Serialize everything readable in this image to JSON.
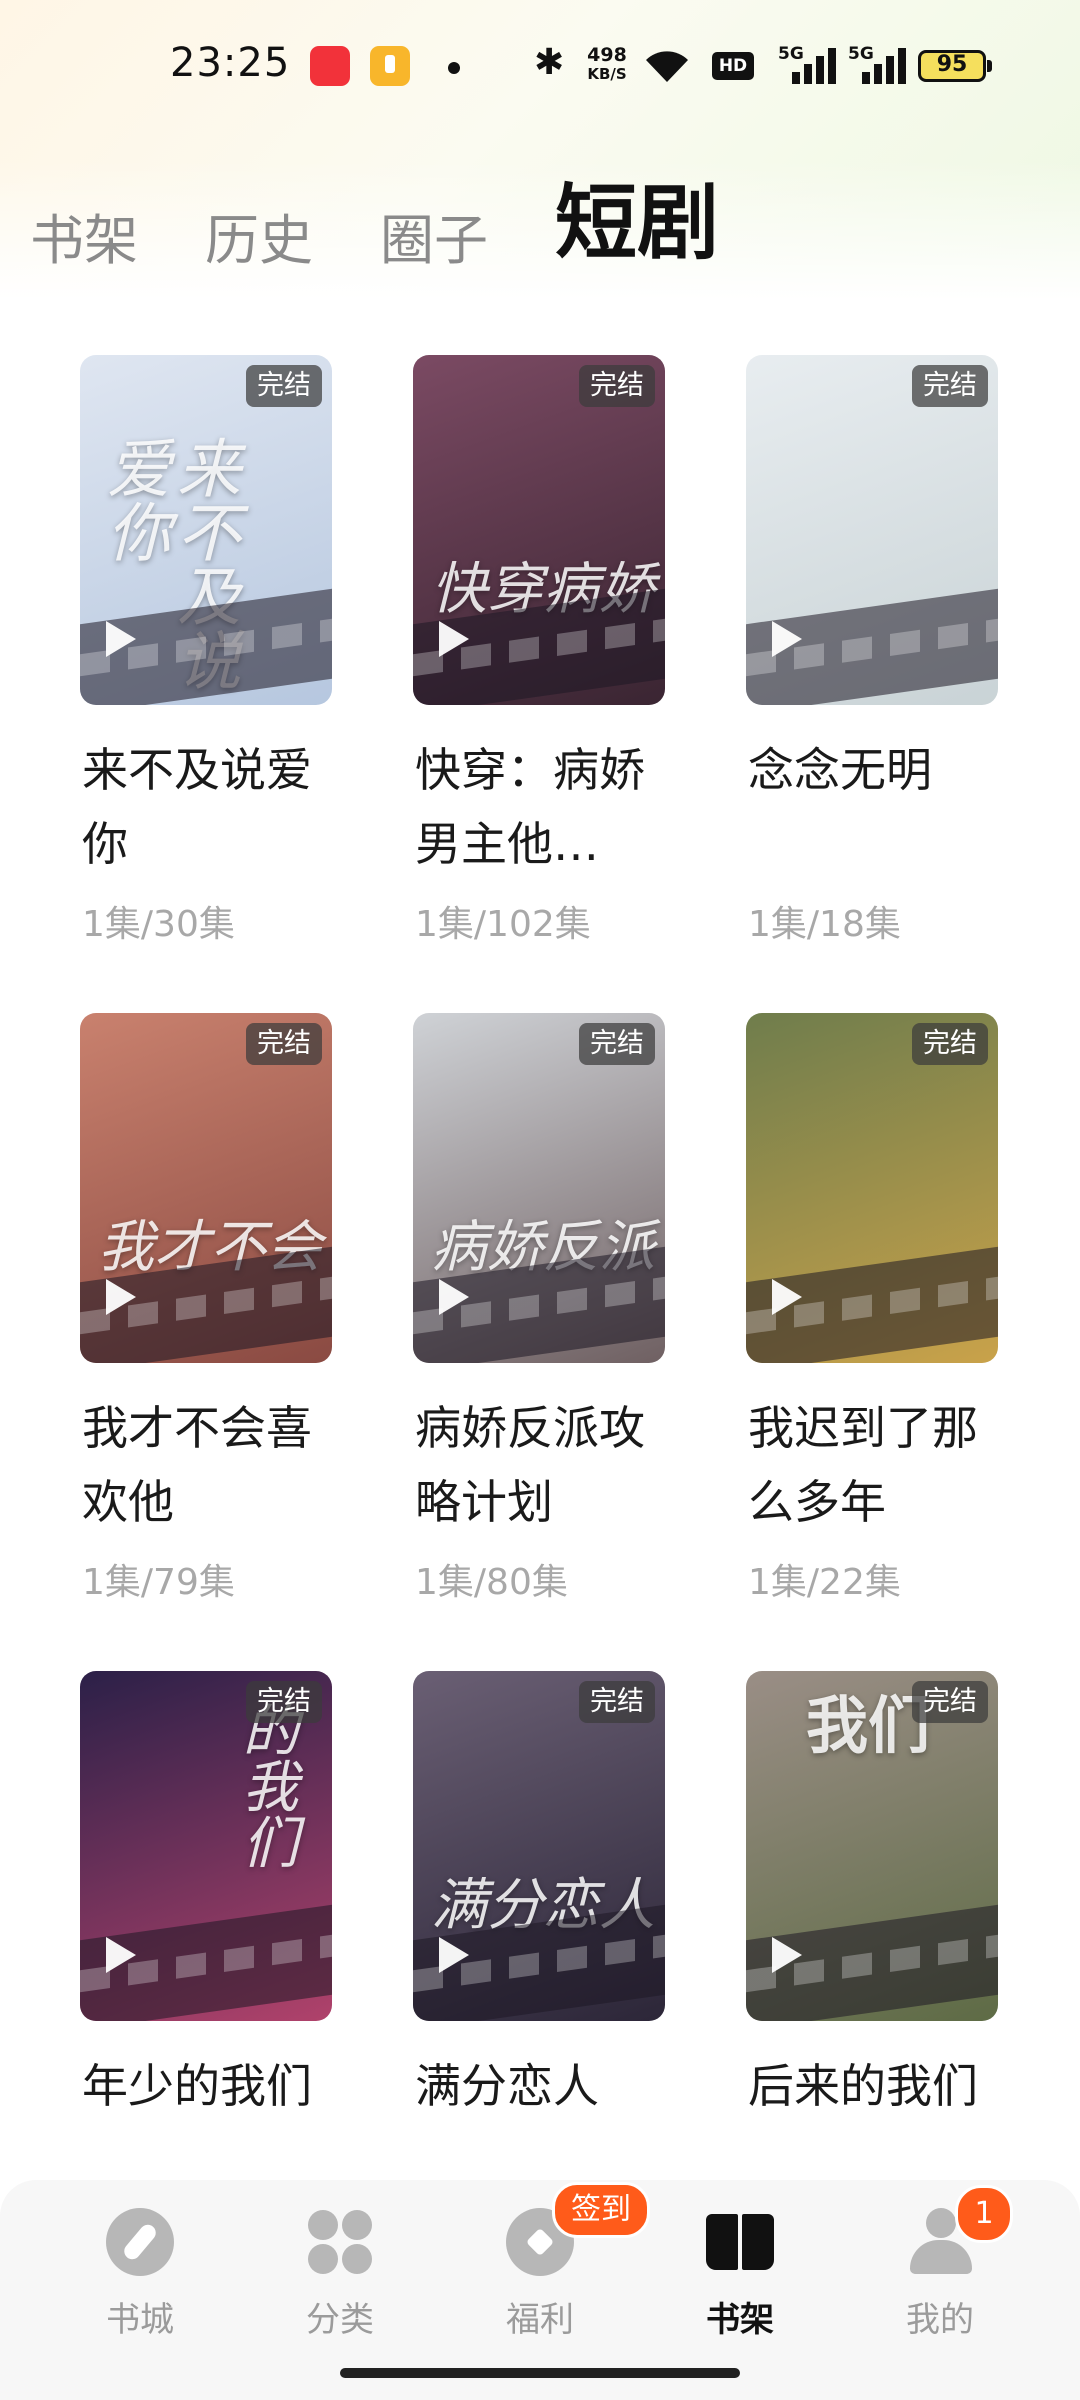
{
  "status_bar": {
    "time": "23:25",
    "net_speed_value": "498",
    "net_speed_unit": "KB/S",
    "hd_label": "HD",
    "signal1_label": "5G",
    "signal2_label": "5G",
    "battery": "95"
  },
  "tabs": [
    {
      "label": "书架",
      "active": false
    },
    {
      "label": "历史",
      "active": false
    },
    {
      "label": "圈子",
      "active": false
    },
    {
      "label": "短剧",
      "active": true
    }
  ],
  "dramas": [
    {
      "title": "来不及说爱你",
      "episodes": "1集/30集",
      "badge": "完结",
      "cover_text": "来不及说爱你",
      "colors": [
        "#dfe6f1",
        "#b6c7df"
      ]
    },
    {
      "title": "快穿：病娇男主他…",
      "episodes": "1集/102集",
      "badge": "完结",
      "cover_text": "快穿病娇",
      "colors": [
        "#7b4a63",
        "#3a2532"
      ]
    },
    {
      "title": "念念无明",
      "episodes": "1集/18集",
      "badge": "完结",
      "cover_text": "",
      "colors": [
        "#e8edf0",
        "#c9d3d6"
      ]
    },
    {
      "title": "我才不会喜欢他",
      "episodes": "1集/79集",
      "badge": "完结",
      "cover_text": "我才不会",
      "colors": [
        "#c9816e",
        "#8a4a42"
      ]
    },
    {
      "title": "病娇反派攻略计划",
      "episodes": "1集/80集",
      "badge": "完结",
      "cover_text": "病娇反派",
      "colors": [
        "#cfd2d6",
        "#6f6062"
      ]
    },
    {
      "title": "我迟到了那么多年",
      "episodes": "1集/22集",
      "badge": "完结",
      "cover_text": "",
      "colors": [
        "#6f7d4c",
        "#c9a24a"
      ]
    },
    {
      "title": "年少的我们",
      "episodes": "",
      "badge": "完结",
      "cover_text": "的我们",
      "colors": [
        "#2b2048",
        "#b0426b"
      ]
    },
    {
      "title": "满分恋人",
      "episodes": "",
      "badge": "完结",
      "cover_text": "满分恋人",
      "colors": [
        "#6a5f74",
        "#2c2638"
      ]
    },
    {
      "title": "后来的我们",
      "episodes": "",
      "badge": "完结",
      "cover_text": "我们",
      "colors": [
        "#9a8e86",
        "#5e6b45"
      ]
    }
  ],
  "bottom_nav": [
    {
      "label": "书城",
      "icon": "compass-icon",
      "active": false
    },
    {
      "label": "分类",
      "icon": "grid-icon",
      "active": false
    },
    {
      "label": "福利",
      "icon": "gift-icon",
      "active": false
    },
    {
      "label": "书架",
      "icon": "book-icon",
      "active": true
    },
    {
      "label": "我的",
      "icon": "person-icon",
      "active": false
    }
  ],
  "signin_badge": "签到",
  "notification_count": "1"
}
